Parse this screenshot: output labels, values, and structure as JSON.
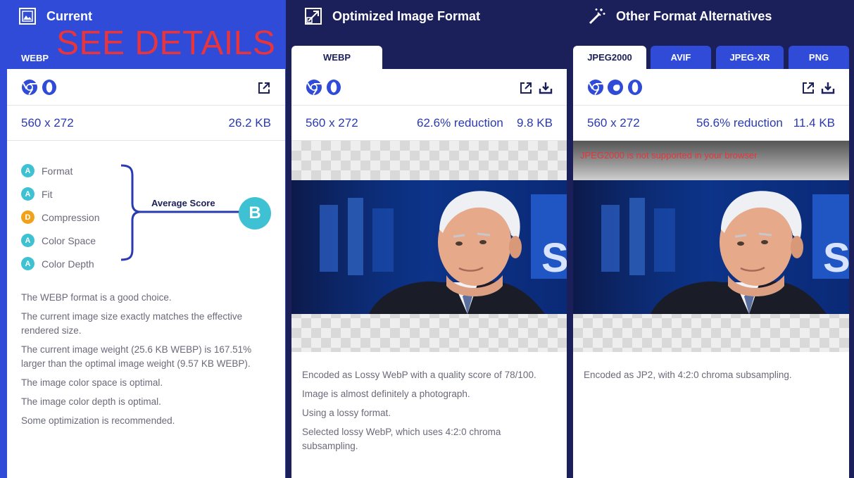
{
  "current": {
    "title": "Current",
    "overlay": "SEE DETAILS",
    "format": "WEBP",
    "dimensions": "560 x 272",
    "weight": "26.2 KB",
    "scores": [
      {
        "grade": "A",
        "label": "Format"
      },
      {
        "grade": "A",
        "label": "Fit"
      },
      {
        "grade": "D",
        "label": "Compression"
      },
      {
        "grade": "A",
        "label": "Color Space"
      },
      {
        "grade": "A",
        "label": "Color Depth"
      }
    ],
    "average_label": "Average Score",
    "average_grade": "B",
    "notes": [
      "The WEBP format is a good choice.",
      "The current image size exactly matches the effective rendered size.",
      "The current image weight (25.6 KB WEBP) is 167.51% larger than the optimal image weight (9.57 KB WEBP).",
      "The image color space is optimal.",
      "The image color depth is optimal.",
      "Some optimization is recommended."
    ]
  },
  "optimized": {
    "title": "Optimized Image Format",
    "tab": "WEBP",
    "dimensions": "560 x 272",
    "reduction": "62.6% reduction",
    "weight": "9.8 KB",
    "notes": [
      "Encoded as Lossy WebP with a quality score of 78/100.",
      "Image is almost definitely a photograph.",
      "Using a lossy format.",
      "Selected lossy WebP, which uses 4:2:0 chroma subsampling."
    ]
  },
  "alternatives": {
    "title": "Other Format Alternatives",
    "tabs": [
      "JPEG2000",
      "AVIF",
      "JPEG-XR",
      "PNG"
    ],
    "active_tab": "JPEG2000",
    "dimensions": "560 x 272",
    "reduction": "56.6% reduction",
    "weight": "11.4 KB",
    "unsupported": "JPEG2000 is not supported in your browser",
    "notes": [
      "Encoded as JP2, with 4:2:0 chroma subsampling."
    ]
  },
  "colors": {
    "current_header": "#2f4bd8",
    "dark_header": "#1b1f5a",
    "accent_text": "#2a3ab0",
    "grade_a": "#3ec1d3",
    "grade_d": "#f0a21b",
    "overlay_red": "#e8343b"
  },
  "icons": [
    "image-icon",
    "resize-icon",
    "magic-wand-icon",
    "chrome-icon",
    "opera-icon",
    "firefox-icon",
    "open-new-window-icon",
    "download-icon"
  ]
}
